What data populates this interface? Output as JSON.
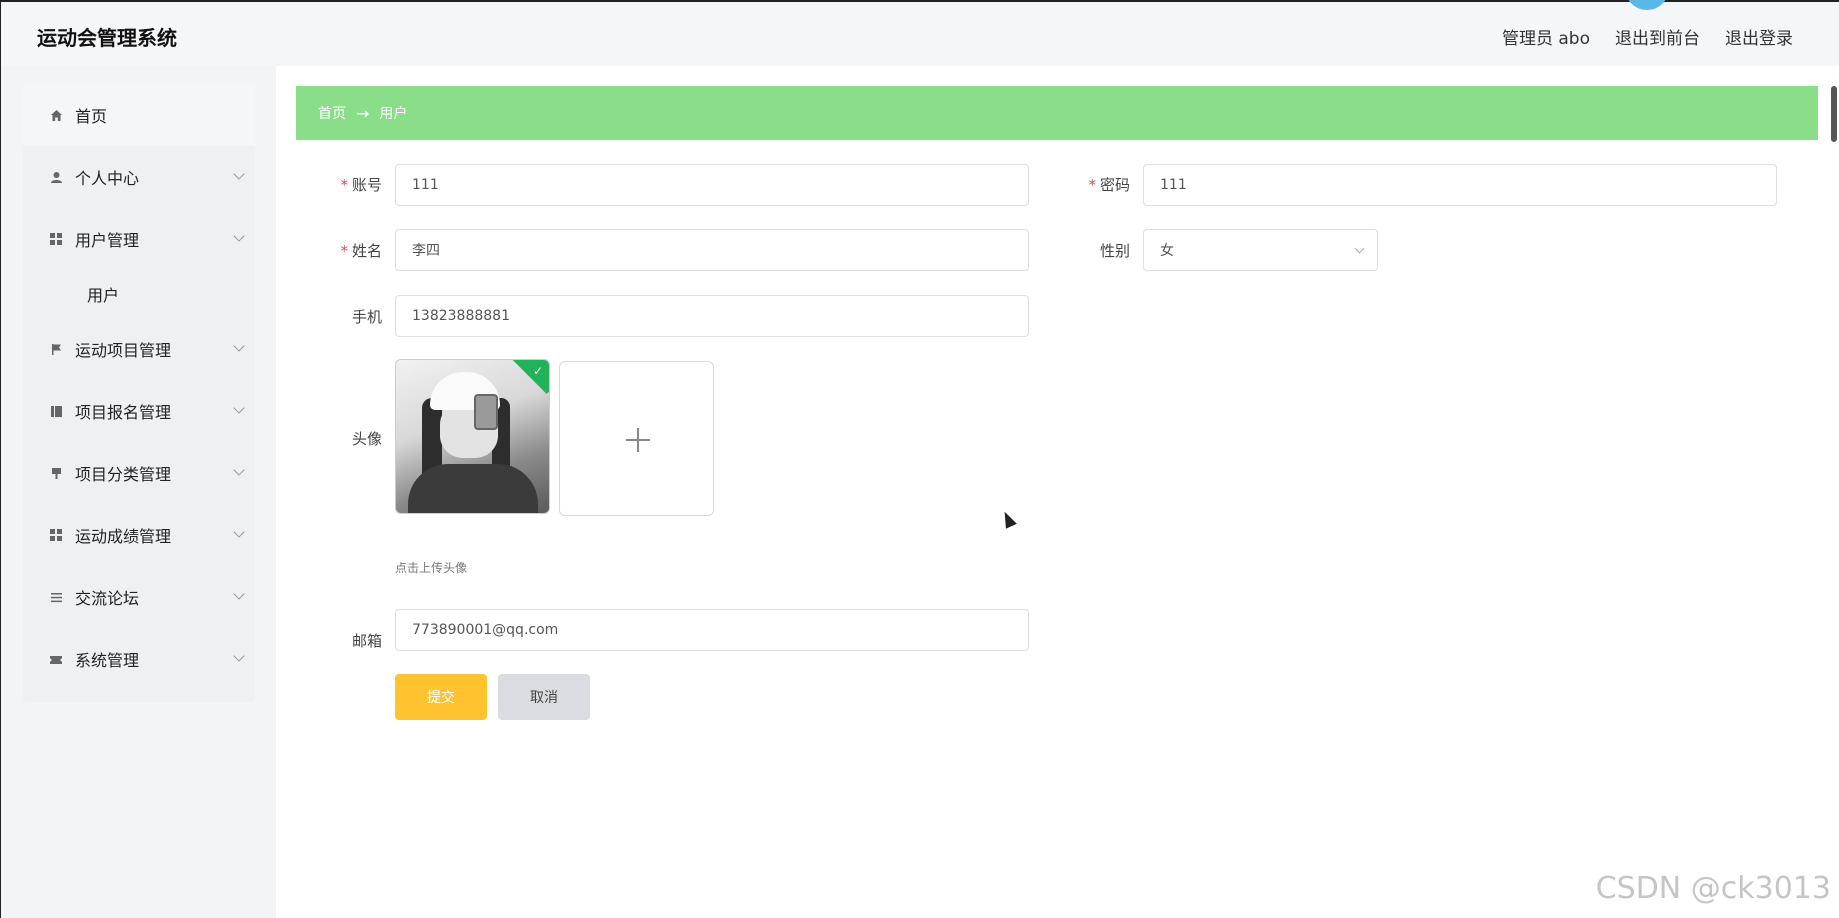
{
  "app": {
    "title": "运动会管理系统"
  },
  "header": {
    "user_label": "管理员 abo",
    "frontend_link": "退出到前台",
    "logout_link": "退出登录"
  },
  "sidebar": {
    "items": [
      {
        "label": "首页",
        "icon": "home-icon"
      },
      {
        "label": "个人中心",
        "icon": "user-icon"
      },
      {
        "label": "用户管理",
        "icon": "grid-icon"
      },
      {
        "label": "运动项目管理",
        "icon": "flag-icon"
      },
      {
        "label": "项目报名管理",
        "icon": "book-icon"
      },
      {
        "label": "项目分类管理",
        "icon": "brush-icon"
      },
      {
        "label": "运动成绩管理",
        "icon": "grid-icon"
      },
      {
        "label": "交流论坛",
        "icon": "list-icon"
      },
      {
        "label": "系统管理",
        "icon": "ticket-icon"
      }
    ],
    "submenu_user": "用户"
  },
  "breadcrumb": {
    "home": "首页",
    "arrow": "→",
    "current": "用户"
  },
  "form": {
    "account": {
      "label": "账号",
      "value": "111"
    },
    "password": {
      "label": "密码",
      "value": "111"
    },
    "name": {
      "label": "姓名",
      "value": "李四"
    },
    "gender": {
      "label": "性别",
      "value": "女"
    },
    "phone": {
      "label": "手机",
      "value": "13823888881"
    },
    "avatar": {
      "label": "头像",
      "tip": "点击上传头像"
    },
    "email": {
      "label": "邮箱",
      "value": "773890001@qq.com"
    },
    "required_mark": "*",
    "submit_label": "提交",
    "cancel_label": "取消"
  },
  "watermark": "CSDN @ck3013",
  "colors": {
    "breadcrumb_bg": "#8ade8a",
    "submit_bg": "#fec32e",
    "cancel_bg": "#d9dde1",
    "required": "#e04b4b"
  }
}
